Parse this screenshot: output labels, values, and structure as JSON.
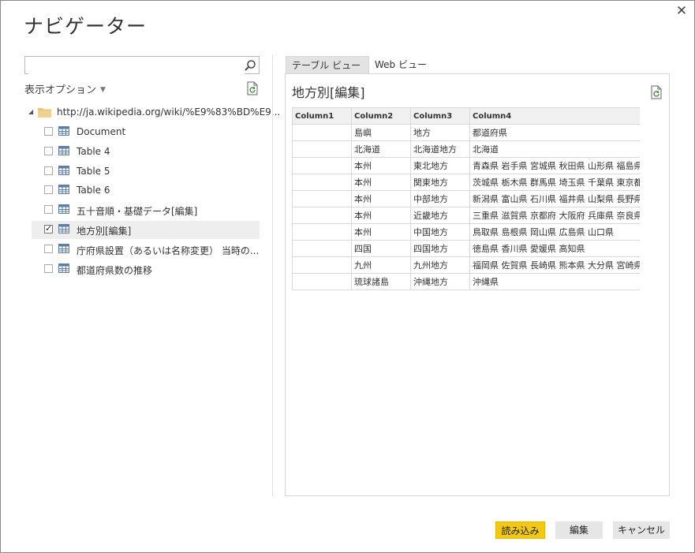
{
  "window": {
    "title": "ナビゲーター"
  },
  "search": {
    "value": "",
    "placeholder": ""
  },
  "options": {
    "label": "表示オプション"
  },
  "tree": {
    "root_url": "http://ja.wikipedia.org/wiki/%E9%83%BD%E9...",
    "items": [
      {
        "label": "Document",
        "checked": false
      },
      {
        "label": "Table 4",
        "checked": false
      },
      {
        "label": "Table 5",
        "checked": false
      },
      {
        "label": "Table 6",
        "checked": false
      },
      {
        "label": "五十音順・基礎データ[編集]",
        "checked": false
      },
      {
        "label": "地方別[編集]",
        "checked": true
      },
      {
        "label": "庁府県設置（あるいは名称変更） 当時の...",
        "checked": false
      },
      {
        "label": "都道府県数の推移",
        "checked": false
      }
    ]
  },
  "tabs": [
    {
      "label": "テーブル ビュー",
      "active": true
    },
    {
      "label": "Web ビュー",
      "active": false
    }
  ],
  "preview": {
    "title": "地方別[編集]",
    "columns": [
      "Column1",
      "Column2",
      "Column3",
      "Column4"
    ],
    "rows": [
      [
        "",
        "島嶼",
        "地方",
        "都道府県"
      ],
      [
        "",
        "北海道",
        "北海道地方",
        "北海道"
      ],
      [
        "",
        "本州",
        "東北地方",
        "青森県 岩手県 宮城県 秋田県 山形県 福島県"
      ],
      [
        "",
        "本州",
        "関東地方",
        "茨城県 栃木県 群馬県 埼玉県 千葉県 東京都"
      ],
      [
        "",
        "本州",
        "中部地方",
        "新潟県 富山県 石川県 福井県 山梨県 長野県"
      ],
      [
        "",
        "本州",
        "近畿地方",
        "三重県 滋賀県 京都府 大阪府 兵庫県 奈良県"
      ],
      [
        "",
        "本州",
        "中国地方",
        "鳥取県 島根県 岡山県 広島県 山口県"
      ],
      [
        "",
        "四国",
        "四国地方",
        "徳島県 香川県 愛媛県 高知県"
      ],
      [
        "",
        "九州",
        "九州地方",
        "福岡県 佐賀県 長崎県 熊本県 大分県 宮崎県"
      ],
      [
        "",
        "琉球諸島",
        "沖縄地方",
        "沖縄県"
      ]
    ]
  },
  "buttons": {
    "load": "読み込み",
    "edit": "編集",
    "cancel": "キャンセル"
  },
  "colors": {
    "primary_button": "#f2c811",
    "selected_row": "#eeeeee"
  },
  "icons": {
    "close": "close-icon",
    "search": "search-icon",
    "refresh": "refresh-icon",
    "folder": "folder-icon",
    "table": "table-icon"
  }
}
